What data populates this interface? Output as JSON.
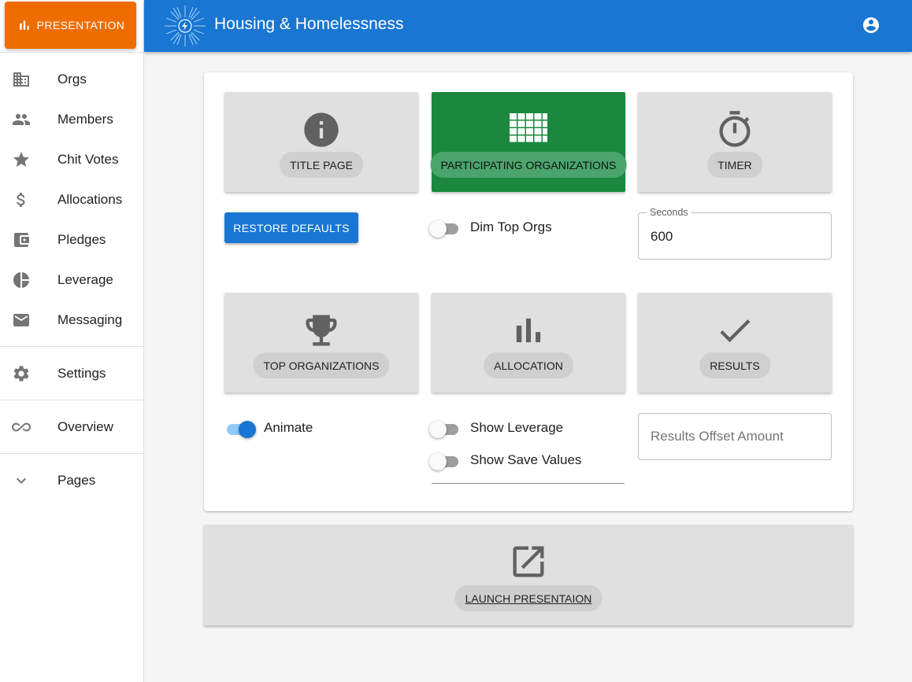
{
  "sidebar": {
    "presentation_label": "PRESENTATION",
    "items": [
      {
        "label": "Orgs",
        "icon": "building-icon"
      },
      {
        "label": "Members",
        "icon": "people-icon"
      },
      {
        "label": "Chit Votes",
        "icon": "star-icon"
      },
      {
        "label": "Allocations",
        "icon": "dollar-icon"
      },
      {
        "label": "Pledges",
        "icon": "wallet-icon"
      },
      {
        "label": "Leverage",
        "icon": "pie-chart-icon"
      },
      {
        "label": "Messaging",
        "icon": "mail-icon"
      }
    ],
    "settings_label": "Settings",
    "overview_label": "Overview",
    "pages_label": "Pages"
  },
  "header": {
    "title": "Housing & Homelessness"
  },
  "tiles": {
    "title_page": "TITLE PAGE",
    "participating": "PARTICIPATING ORGANIZATIONS",
    "timer": "TIMER",
    "top_orgs": "TOP ORGANIZATIONS",
    "allocation": "ALLOCATION",
    "results": "RESULTS",
    "launch": "LAUNCH PRESENTAION"
  },
  "controls": {
    "restore_defaults": "RESTORE DEFAULTS",
    "dim_top_orgs": "Dim Top Orgs",
    "seconds_label": "Seconds",
    "seconds_value": "600",
    "animate": "Animate",
    "show_leverage": "Show Leverage",
    "show_save_values": "Show Save Values",
    "results_offset_placeholder": "Results Offset Amount"
  },
  "colors": {
    "primary": "#1976d2",
    "presentation": "#ef6c00",
    "active_tile": "#1b873f"
  }
}
